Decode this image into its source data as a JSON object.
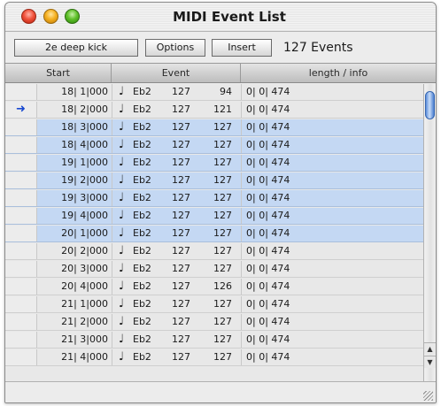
{
  "window": {
    "title": "MIDI Event List"
  },
  "toolbar": {
    "track_label": "2e deep kick",
    "options_label": "Options",
    "insert_label": "Insert",
    "event_count": "127 Events"
  },
  "columns": {
    "start": "Start",
    "event": "Event",
    "info": "length / info"
  },
  "colors": {
    "selection": "#c4d8f3",
    "arrow": "#1848d0"
  },
  "icons": {
    "note": "quarter-note-icon",
    "arrow": "playhead-arrow-icon"
  },
  "rows": [
    {
      "start": "18| 1|000",
      "pitch": "Eb2",
      "velocity": "127",
      "release": "94",
      "length": "0| 0| 474",
      "selected": false,
      "current": false
    },
    {
      "start": "18| 2|000",
      "pitch": "Eb2",
      "velocity": "127",
      "release": "121",
      "length": "0| 0| 474",
      "selected": false,
      "current": true
    },
    {
      "start": "18| 3|000",
      "pitch": "Eb2",
      "velocity": "127",
      "release": "127",
      "length": "0| 0| 474",
      "selected": true,
      "current": false
    },
    {
      "start": "18| 4|000",
      "pitch": "Eb2",
      "velocity": "127",
      "release": "127",
      "length": "0| 0| 474",
      "selected": true,
      "current": false
    },
    {
      "start": "19| 1|000",
      "pitch": "Eb2",
      "velocity": "127",
      "release": "127",
      "length": "0| 0| 474",
      "selected": true,
      "current": false
    },
    {
      "start": "19| 2|000",
      "pitch": "Eb2",
      "velocity": "127",
      "release": "127",
      "length": "0| 0| 474",
      "selected": true,
      "current": false
    },
    {
      "start": "19| 3|000",
      "pitch": "Eb2",
      "velocity": "127",
      "release": "127",
      "length": "0| 0| 474",
      "selected": true,
      "current": false
    },
    {
      "start": "19| 4|000",
      "pitch": "Eb2",
      "velocity": "127",
      "release": "127",
      "length": "0| 0| 474",
      "selected": true,
      "current": false
    },
    {
      "start": "20| 1|000",
      "pitch": "Eb2",
      "velocity": "127",
      "release": "127",
      "length": "0| 0| 474",
      "selected": true,
      "current": false
    },
    {
      "start": "20| 2|000",
      "pitch": "Eb2",
      "velocity": "127",
      "release": "127",
      "length": "0| 0| 474",
      "selected": false,
      "current": false
    },
    {
      "start": "20| 3|000",
      "pitch": "Eb2",
      "velocity": "127",
      "release": "127",
      "length": "0| 0| 474",
      "selected": false,
      "current": false
    },
    {
      "start": "20| 4|000",
      "pitch": "Eb2",
      "velocity": "127",
      "release": "126",
      "length": "0| 0| 474",
      "selected": false,
      "current": false
    },
    {
      "start": "21| 1|000",
      "pitch": "Eb2",
      "velocity": "127",
      "release": "127",
      "length": "0| 0| 474",
      "selected": false,
      "current": false
    },
    {
      "start": "21| 2|000",
      "pitch": "Eb2",
      "velocity": "127",
      "release": "127",
      "length": "0| 0| 474",
      "selected": false,
      "current": false
    },
    {
      "start": "21| 3|000",
      "pitch": "Eb2",
      "velocity": "127",
      "release": "127",
      "length": "0| 0| 474",
      "selected": false,
      "current": false
    },
    {
      "start": "21| 4|000",
      "pitch": "Eb2",
      "velocity": "127",
      "release": "127",
      "length": "0| 0| 474",
      "selected": false,
      "current": false
    }
  ]
}
